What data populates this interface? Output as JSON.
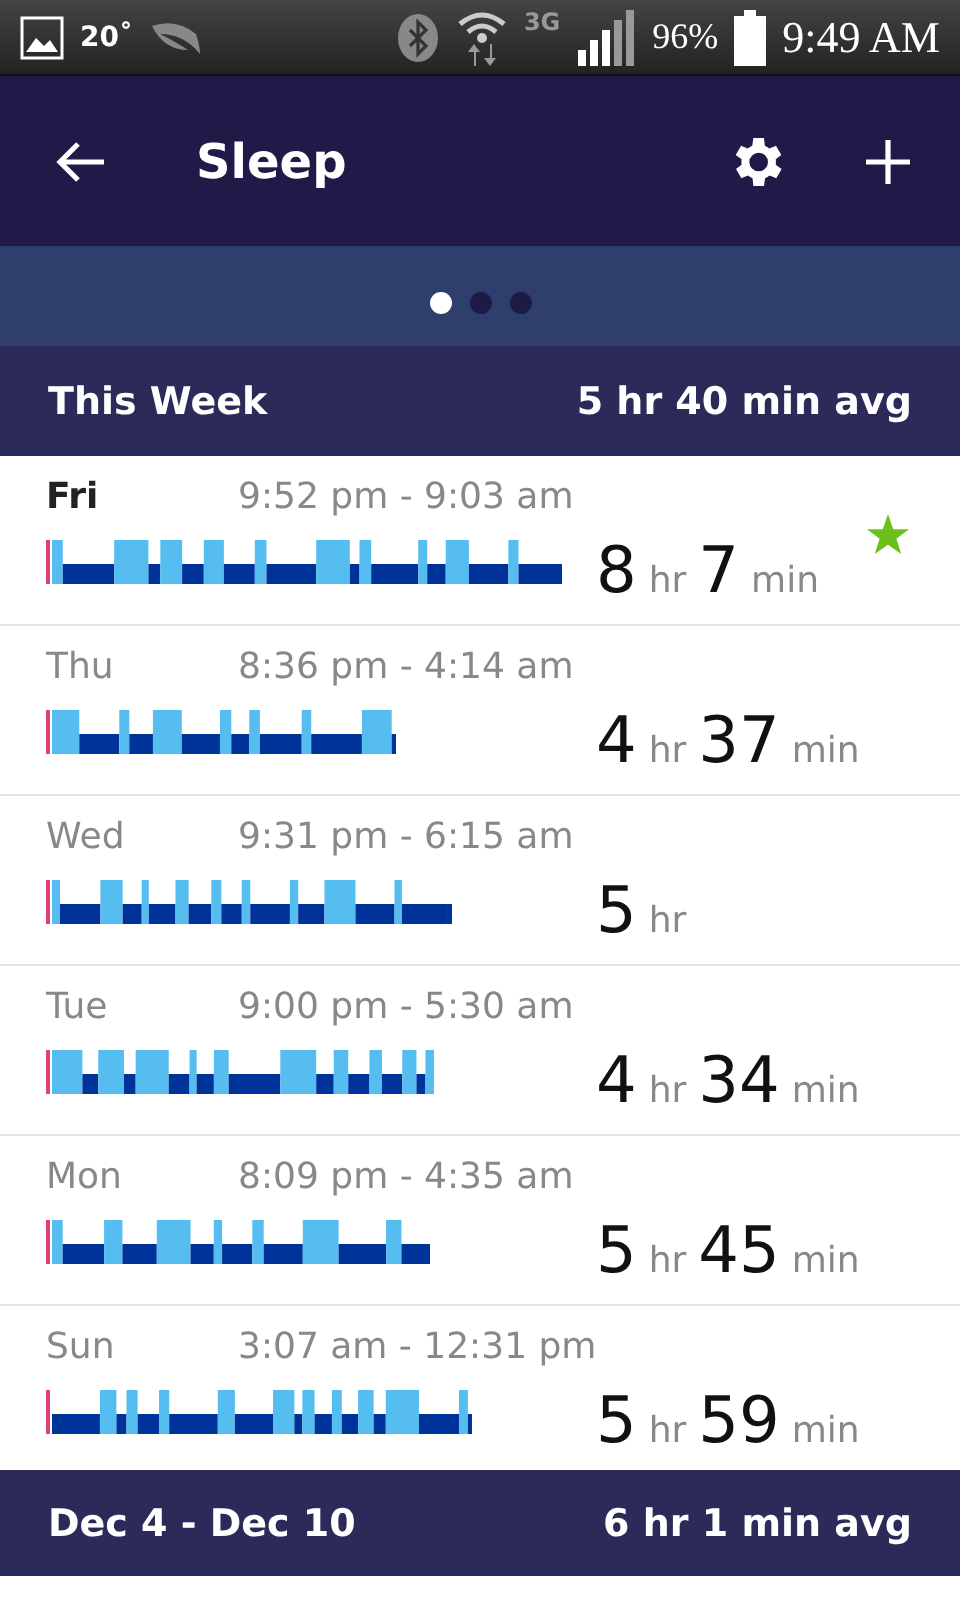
{
  "status_bar": {
    "temperature": "20˚",
    "network": "3G",
    "battery": "96%",
    "time": "9:49 AM"
  },
  "header": {
    "title": "Sleep"
  },
  "carousel": {
    "pages": [
      {
        "selected": true
      },
      {
        "selected": false
      },
      {
        "selected": false
      }
    ]
  },
  "week_summary": {
    "label": "This Week",
    "average": "5 hr 40 min avg"
  },
  "days": [
    {
      "day": "Fri",
      "selected": true,
      "time_range": "9:52 pm - 9:03 am",
      "starred": true,
      "duration": [
        {
          "value": "8",
          "unit": "hr"
        },
        {
          "value": "7",
          "unit": "min"
        }
      ]
    },
    {
      "day": "Thu",
      "selected": false,
      "time_range": "8:36 pm - 4:14 am",
      "starred": false,
      "duration": [
        {
          "value": "4",
          "unit": "hr"
        },
        {
          "value": "37",
          "unit": "min"
        }
      ]
    },
    {
      "day": "Wed",
      "selected": false,
      "time_range": "9:31 pm - 6:15 am",
      "starred": false,
      "duration": [
        {
          "value": "5",
          "unit": "hr"
        }
      ]
    },
    {
      "day": "Tue",
      "selected": false,
      "time_range": "9:00 pm - 5:30 am",
      "starred": false,
      "duration": [
        {
          "value": "4",
          "unit": "hr"
        },
        {
          "value": "34",
          "unit": "min"
        }
      ]
    },
    {
      "day": "Mon",
      "selected": false,
      "time_range": "8:09 pm - 4:35 am",
      "starred": false,
      "duration": [
        {
          "value": "5",
          "unit": "hr"
        },
        {
          "value": "45",
          "unit": "min"
        }
      ]
    },
    {
      "day": "Sun",
      "selected": false,
      "time_range": "3:07 am - 12:31 pm",
      "starred": false,
      "duration": [
        {
          "value": "5",
          "unit": "hr"
        },
        {
          "value": "59",
          "unit": "min"
        }
      ]
    }
  ],
  "footer": {
    "range": "Dec 4 - Dec 10",
    "average": "6 hr 1 min avg"
  }
}
